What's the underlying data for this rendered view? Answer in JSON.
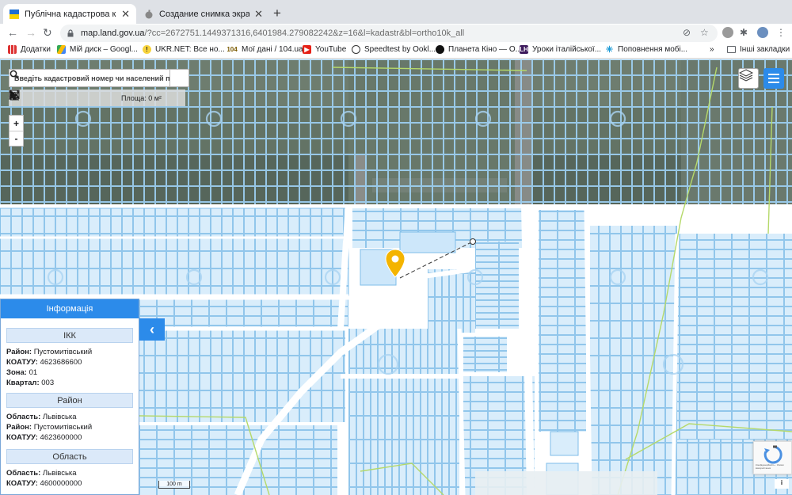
{
  "browser": {
    "tabs": [
      {
        "title": "Публічна кадастрова карта У",
        "close": "✕",
        "active": true
      },
      {
        "title": "Создание снимка экрана на",
        "close": "✕",
        "active": false
      }
    ],
    "new_tab": "+",
    "url_host": "map.land.gov.ua",
    "url_rest": "/?cc=2672751.1449371316,6401984.279082242&z=16&l=kadastr&bl=ortho10k_all",
    "bookmarks": [
      {
        "label": "Додатки",
        "icon": "apps-icon"
      },
      {
        "label": "Мій диск – Googl...",
        "icon": "drive-icon"
      },
      {
        "label": "UKR.NET: Все но...",
        "icon": "ukrnet-icon"
      },
      {
        "label": "Мої дані / 104.ua",
        "icon": "104-icon"
      },
      {
        "label": "YouTube",
        "icon": "youtube-icon"
      },
      {
        "label": "Speedtest by Ookl...",
        "icon": "speedtest-icon"
      },
      {
        "label": "Планета Кіно — О...",
        "icon": "planeta-icon"
      },
      {
        "label": "Уроки італійської...",
        "icon": "lh-icon"
      },
      {
        "label": "Поповнення мобі...",
        "icon": "star-icon"
      }
    ],
    "more_bookmarks": "»",
    "other_bookmarks": "Інші закладки"
  },
  "map": {
    "search_placeholder": "Введіть кадастровий номер чи населений пункт",
    "area_label": "Площа: 0 м²",
    "zoom_in": "+",
    "zoom_out": "-",
    "scale_label": "100 m",
    "recaptcha_text": "Конфіденційність - Умови використання",
    "info_btn": "i",
    "collapse_icon": "‹"
  },
  "info_panel": {
    "header": "Інформація",
    "sections": [
      {
        "title": "ІКК",
        "rows": [
          {
            "key": "Район:",
            "value": "Пустомитівський"
          },
          {
            "key": "КОАТУУ:",
            "value": "4623686600"
          },
          {
            "key": "Зона:",
            "value": "01"
          },
          {
            "key": "Квартал:",
            "value": "003"
          }
        ]
      },
      {
        "title": "Район",
        "rows": [
          {
            "key": "Область:",
            "value": "Львівська"
          },
          {
            "key": "Район:",
            "value": "Пустомитівський"
          },
          {
            "key": "КОАТУУ:",
            "value": "4623600000"
          }
        ]
      },
      {
        "title": "Область",
        "rows": [
          {
            "key": "Область:",
            "value": "Львівська"
          },
          {
            "key": "КОАТУУ:",
            "value": "4600000000"
          }
        ]
      }
    ]
  },
  "colors": {
    "accent": "#2c8bea",
    "parcel_fill": "#d6ecfb",
    "parcel_stroke": "#7fbde8",
    "boundary": "#b5d96a",
    "marker": "#f4b400"
  }
}
